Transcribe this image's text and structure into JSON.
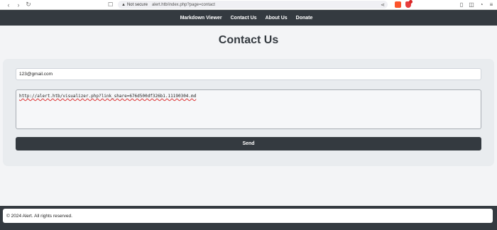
{
  "browser": {
    "security_label": "Not secure",
    "url": "alert.htb/index.php?page=contact"
  },
  "nav": {
    "items": [
      {
        "label": "Markdown Viewer"
      },
      {
        "label": "Contact Us"
      },
      {
        "label": "About Us"
      },
      {
        "label": "Donate"
      }
    ]
  },
  "page": {
    "title": "Contact Us"
  },
  "form": {
    "email_value": "123@gmail.com",
    "message_value": "http://alert.htb/visualizer.php?link_share=676d500df326b1.11190304.md",
    "send_label": "Send"
  },
  "footer": {
    "text": "© 2024 Alert. All rights reserved."
  }
}
